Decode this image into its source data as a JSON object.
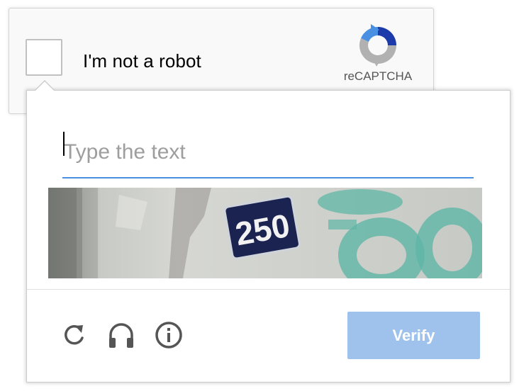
{
  "anchor": {
    "checkbox_label": "I'm not a robot",
    "brand": "reCAPTCHA",
    "checked": false
  },
  "challenge": {
    "input": {
      "placeholder": "Type the text",
      "value": ""
    },
    "captcha_text": "250",
    "controls": {
      "reload_icon": "reload-icon",
      "audio_icon": "headphones-icon",
      "info_icon": "info-icon"
    },
    "verify_label": "Verify"
  },
  "colors": {
    "input_underline": "#4a90e2",
    "verify_button": "#9fc2ed",
    "logo_blue": "#1c3aa9",
    "logo_light_blue": "#4a90e2",
    "logo_gray": "#b1b1b1"
  }
}
